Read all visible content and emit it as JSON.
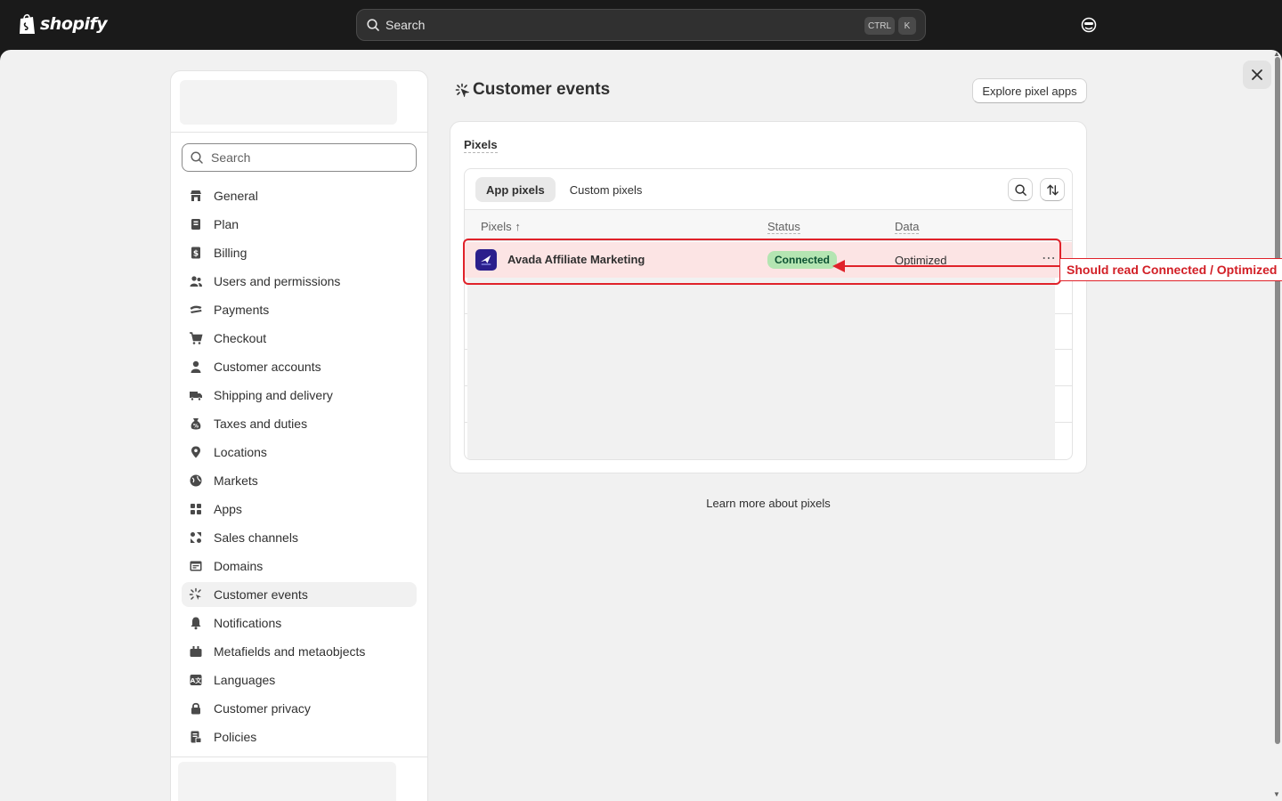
{
  "topbar": {
    "brand": "shopify",
    "search_placeholder": "Search",
    "shortcut_ctrl": "CTRL",
    "shortcut_k": "K"
  },
  "sidebar": {
    "search_placeholder": "Search",
    "items": [
      {
        "label": "General",
        "icon": "store-icon"
      },
      {
        "label": "Plan",
        "icon": "plan-icon"
      },
      {
        "label": "Billing",
        "icon": "billing-icon"
      },
      {
        "label": "Users and permissions",
        "icon": "users-icon"
      },
      {
        "label": "Payments",
        "icon": "payments-icon"
      },
      {
        "label": "Checkout",
        "icon": "cart-icon"
      },
      {
        "label": "Customer accounts",
        "icon": "person-icon"
      },
      {
        "label": "Shipping and delivery",
        "icon": "truck-icon"
      },
      {
        "label": "Taxes and duties",
        "icon": "taxes-icon"
      },
      {
        "label": "Locations",
        "icon": "location-icon"
      },
      {
        "label": "Markets",
        "icon": "globe-icon"
      },
      {
        "label": "Apps",
        "icon": "apps-icon"
      },
      {
        "label": "Sales channels",
        "icon": "sales-channels-icon"
      },
      {
        "label": "Domains",
        "icon": "domains-icon"
      },
      {
        "label": "Customer events",
        "icon": "customer-events-icon",
        "active": true
      },
      {
        "label": "Notifications",
        "icon": "bell-icon"
      },
      {
        "label": "Metafields and metaobjects",
        "icon": "metafields-icon"
      },
      {
        "label": "Languages",
        "icon": "languages-icon"
      },
      {
        "label": "Customer privacy",
        "icon": "lock-icon"
      },
      {
        "label": "Policies",
        "icon": "policies-icon"
      }
    ]
  },
  "page": {
    "title": "Customer events",
    "explore_button": "Explore pixel apps",
    "card_title": "Pixels",
    "tabs": [
      {
        "label": "App pixels",
        "active": true
      },
      {
        "label": "Custom pixels",
        "active": false
      }
    ],
    "columns": {
      "pixels": "Pixels",
      "status": "Status",
      "data": "Data"
    },
    "rows": [
      {
        "name": "Avada Affiliate Marketing",
        "status": "Connected",
        "data": "Optimized"
      }
    ],
    "learn_more": "Learn more about pixels"
  },
  "annotation": {
    "text": "Should read Connected / Optimized",
    "color": "#e0222a"
  },
  "colors": {
    "badge_bg": "#b4e5b2",
    "badge_text": "#0c5132",
    "row_highlight": "#fce4e4"
  }
}
